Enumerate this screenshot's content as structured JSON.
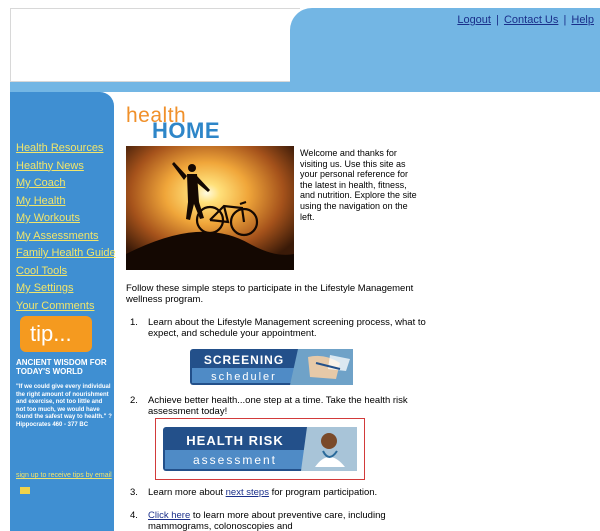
{
  "header": {
    "links": [
      {
        "label": "Logout"
      },
      {
        "label": "Contact Us"
      },
      {
        "label": "Help"
      }
    ],
    "separator": "|"
  },
  "sidebar": {
    "items": [
      {
        "label": "Health Resources"
      },
      {
        "label": "Healthy News"
      },
      {
        "label": "My Coach"
      },
      {
        "label": "My Health"
      },
      {
        "label": "My Workouts"
      },
      {
        "label": "My Assessments"
      },
      {
        "label": "Family Health Guide"
      },
      {
        "label": "Cool Tools"
      },
      {
        "label": "My Settings"
      },
      {
        "label": "Your Comments"
      }
    ],
    "tip": {
      "badge": "tip...",
      "title": "Ancient wisdom for today's world",
      "quote": "\"If we could give every individual the right amount of nourishment and exercise, not too little and not too much, we would have found the safest way to health.\" ? Hippocrates 460 - 377 BC",
      "signup": "sign up to receive tips by email"
    }
  },
  "logo": {
    "health": "health",
    "home": "HOME"
  },
  "welcome": "Welcome and thanks for visiting us. Use this site as your personal reference for the latest in health, fitness, and nutrition. Explore the site using the navigation on the left.",
  "steps_intro": "Follow these simple steps to participate in the Lifestyle Management wellness program.",
  "steps": [
    {
      "num": "1.",
      "text": "Learn about the Lifestyle Management screening process, what to expect, and schedule your appointment."
    },
    {
      "num": "2.",
      "text": "Achieve better health...one step at a time. Take the health risk assessment today!"
    },
    {
      "num": "3.",
      "pre": "Learn more about ",
      "link": "next steps",
      "post": " for program participation."
    },
    {
      "num": "4.",
      "link": "Click here",
      "post": " to learn more about preventive care, including mammograms, colonoscopies and"
    }
  ],
  "buttons": {
    "screening": {
      "top": "SCREENING",
      "bottom": "scheduler"
    },
    "risk": {
      "top": "HEALTH RISK",
      "bottom": "assessment"
    }
  },
  "colors": {
    "header_blue": "#73b6e4",
    "sidebar_blue": "#3f8fd2",
    "nav_link": "#f1e56b",
    "tip_orange": "#f59a1f",
    "logo_orange": "#f0902a",
    "logo_blue": "#2e86c8",
    "button_navy": "#23508a",
    "highlight_red": "#d23a3a"
  }
}
